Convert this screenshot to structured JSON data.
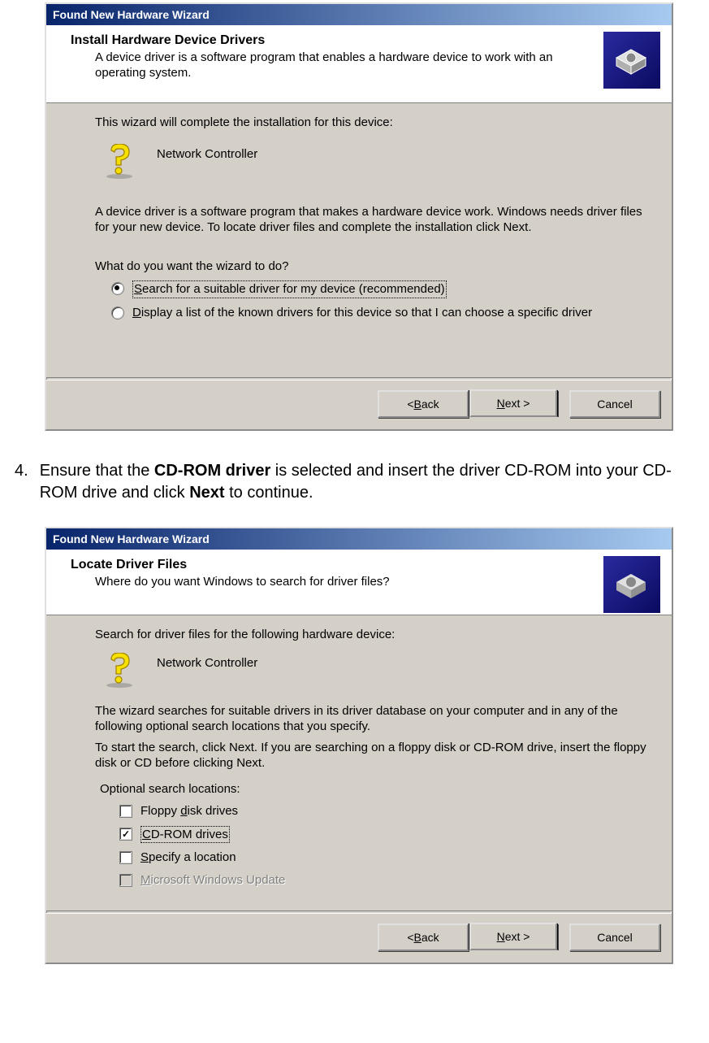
{
  "dialog1": {
    "title": "Found New Hardware Wizard",
    "header_title": "Install Hardware Device Drivers",
    "header_sub": "A device driver is a software program that enables a hardware device to work with an operating system.",
    "intro": "This wizard will complete the installation for this device:",
    "device": "Network Controller",
    "explain": "A device driver is a software program that makes a hardware device work. Windows needs driver files for your new device. To locate driver files and complete the installation click Next.",
    "question": "What do you want the wizard to do?",
    "opt_search_pre": "S",
    "opt_search_rest": "earch for a suitable driver for my device (recommended)",
    "opt_display_pre": "D",
    "opt_display_rest": "isplay a list of the known drivers for this device so that I can choose a specific driver",
    "btn_back_pre": "< ",
    "btn_back_u": "B",
    "btn_back_rest": "ack",
    "btn_next_u": "N",
    "btn_next_rest": "ext >",
    "btn_cancel": "Cancel"
  },
  "instruction": {
    "num": "4.",
    "pre": "Ensure that the ",
    "bold1": "CD-ROM driver",
    "mid": " is selected and insert the driver CD-ROM into your CD-ROM drive and click ",
    "bold2": "Next",
    "post": " to continue."
  },
  "dialog2": {
    "title": "Found New Hardware Wizard",
    "header_title": "Locate Driver Files",
    "header_sub": "Where do you want Windows to search for driver files?",
    "line1": "Search for driver files for the following hardware device:",
    "device": "Network Controller",
    "para1": "The wizard searches for suitable drivers in its driver database on your computer and in any of the following optional search locations that you specify.",
    "para2": "To start the search, click Next. If you are searching on a floppy disk or CD-ROM drive, insert the floppy disk or CD before clicking Next.",
    "opt_label": "Optional search locations:",
    "floppy_pre": "Floppy ",
    "floppy_u": "d",
    "floppy_rest": "isk drives",
    "cdrom_u": "C",
    "cdrom_rest": "D-ROM drives",
    "specify_u": "S",
    "specify_rest": "pecify a location",
    "msupdate_u": "M",
    "msupdate_rest": "icrosoft Windows Update",
    "btn_back_pre": "< ",
    "btn_back_u": "B",
    "btn_back_rest": "ack",
    "btn_next_u": "N",
    "btn_next_rest": "ext >",
    "btn_cancel": "Cancel"
  }
}
